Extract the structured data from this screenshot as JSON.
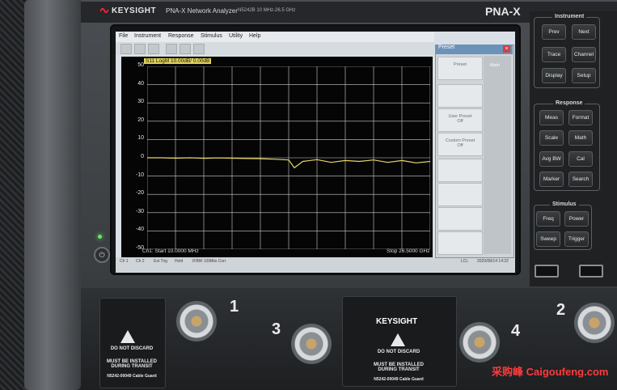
{
  "header": {
    "brand": "KEYSIGHT",
    "model_title": "PNA-X Network Analyzer",
    "model_sub": "N5242B 10 MHz-26.5 GHz",
    "series": "PNA-X"
  },
  "screen_menu": [
    "File",
    "Instrument",
    "Response",
    "Stimulus",
    "Utility",
    "Help"
  ],
  "trace": {
    "label": "S11 LogM 10.00dB/ 0.00dB",
    "channel_start": "Ch1: Start 10.0000 MHz",
    "stop": "Stop 26.5000 GHz"
  },
  "bottom_bar": [
    "Ch 1",
    "Ch 2",
    "Ext Trig",
    "Hold",
    "IFBW 100k",
    "No Corr",
    "LCL",
    "2020/08/14 14:22"
  ],
  "preset_panel": {
    "title": "Preset",
    "close": "×",
    "tab": "Main",
    "buttons": [
      "Preset",
      "",
      "User Preset",
      "Custom Preset",
      "",
      "",
      "",
      ""
    ],
    "button_subs": [
      "",
      "",
      "Off",
      "Off",
      "",
      "",
      "",
      ""
    ]
  },
  "groups": {
    "instrument": {
      "title": "Instrument",
      "buttons": [
        "Prev",
        "Next",
        "Trace",
        "Channel",
        "Display",
        "Setup"
      ]
    },
    "response": {
      "title": "Response",
      "buttons": [
        "Meas",
        "Format",
        "Scale",
        "Math",
        "Avg BW",
        "Cal",
        "Marker",
        "Search"
      ]
    },
    "stimulus": {
      "title": "Stimulus",
      "buttons": [
        "Freq",
        "Power",
        "Sweep",
        "Trigger"
      ]
    }
  },
  "ports": [
    "1",
    "2",
    "3",
    "4"
  ],
  "guards": {
    "text1": "DO NOT DISCARD",
    "text2": "MUST BE INSTALLED DURING TRANSIT",
    "text3": "N5242-00049 Cable Guard"
  },
  "center_guard_brand": "KEYSIGHT",
  "watermark": "采购峰 Caigoufeng.com",
  "chart_data": {
    "type": "line",
    "title": "S11 LogM 10.00dB/ 0.00dB",
    "xlabel": "",
    "ylabel": "",
    "x_range": [
      "10.0000 MHz",
      "26.5000 GHz"
    ],
    "yticks": [
      50,
      40,
      30,
      20,
      10,
      0,
      -10,
      -20,
      -30,
      -40,
      -50
    ],
    "ylim": [
      -50,
      50
    ],
    "grid": true,
    "series": [
      {
        "name": "S11",
        "color": "#e8d56a",
        "x": [
          0,
          0.05,
          0.1,
          0.15,
          0.2,
          0.25,
          0.3,
          0.35,
          0.4,
          0.45,
          0.5,
          0.52,
          0.55,
          0.6,
          0.65,
          0.7,
          0.75,
          0.8,
          0.85,
          0.9,
          0.95,
          1.0
        ],
        "values": [
          0,
          0,
          -0.2,
          0,
          -0.3,
          -0.1,
          -0.2,
          -0.4,
          -0.5,
          -0.8,
          -1.2,
          -5.5,
          -2.0,
          -1.0,
          -2.5,
          -1.5,
          -2.0,
          -1.2,
          -2.5,
          -1.5,
          -2.8,
          -2.0
        ]
      }
    ]
  }
}
